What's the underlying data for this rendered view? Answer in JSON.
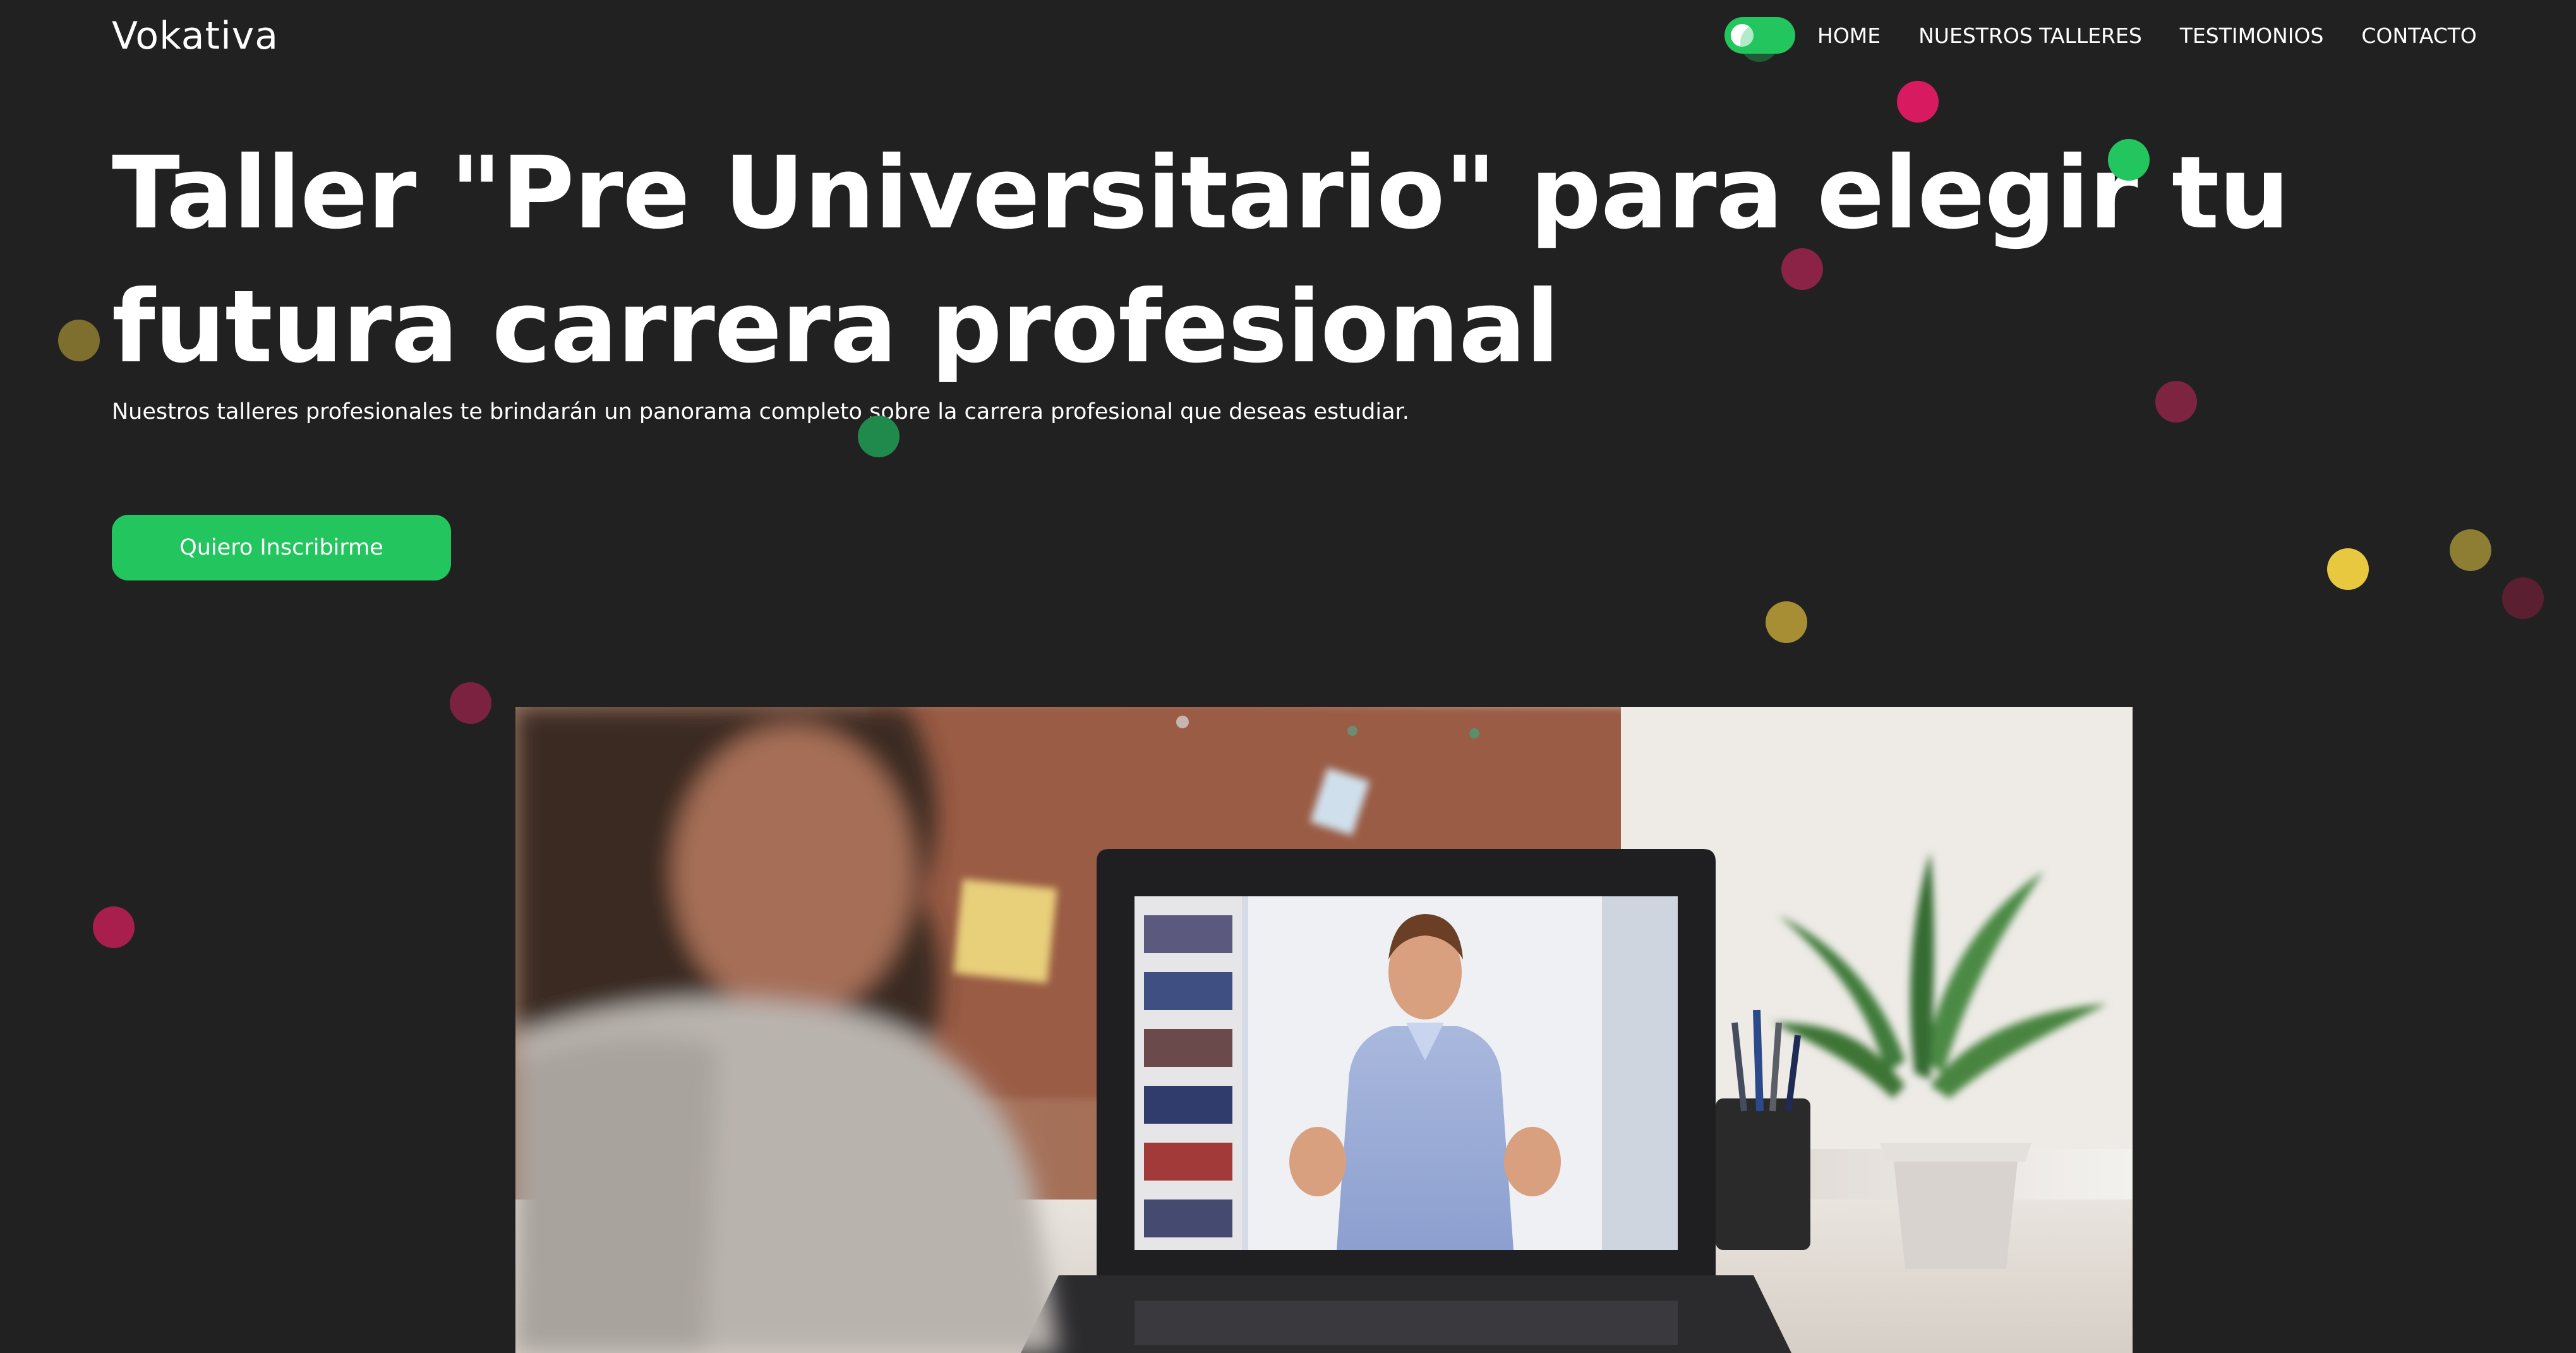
{
  "header": {
    "brand": "Vokativa",
    "nav": [
      {
        "label": "HOME"
      },
      {
        "label": "NUESTROS TALLERES"
      },
      {
        "label": "TESTIMONIOS"
      },
      {
        "label": "CONTACTO"
      }
    ],
    "theme_toggle": {
      "icon": "toggle-switch-icon",
      "state": "on"
    }
  },
  "hero": {
    "title": "Taller \"Pre Universitario\" para elegir tu futura carrera profesional",
    "subtitle": "Nuestros talleres profesionales te brindarán un panorama completo sobre la carrera profesional que deseas estudiar.",
    "cta_label": "Quiero Inscribirme"
  },
  "colors": {
    "background": "#212121",
    "accent": "#22c55e",
    "text": "#ffffff",
    "dot_pink": "#c2185b",
    "dot_olive": "#8a7a2e",
    "dot_yellow": "#e6c84a",
    "dot_maroon": "#6b1f34"
  }
}
